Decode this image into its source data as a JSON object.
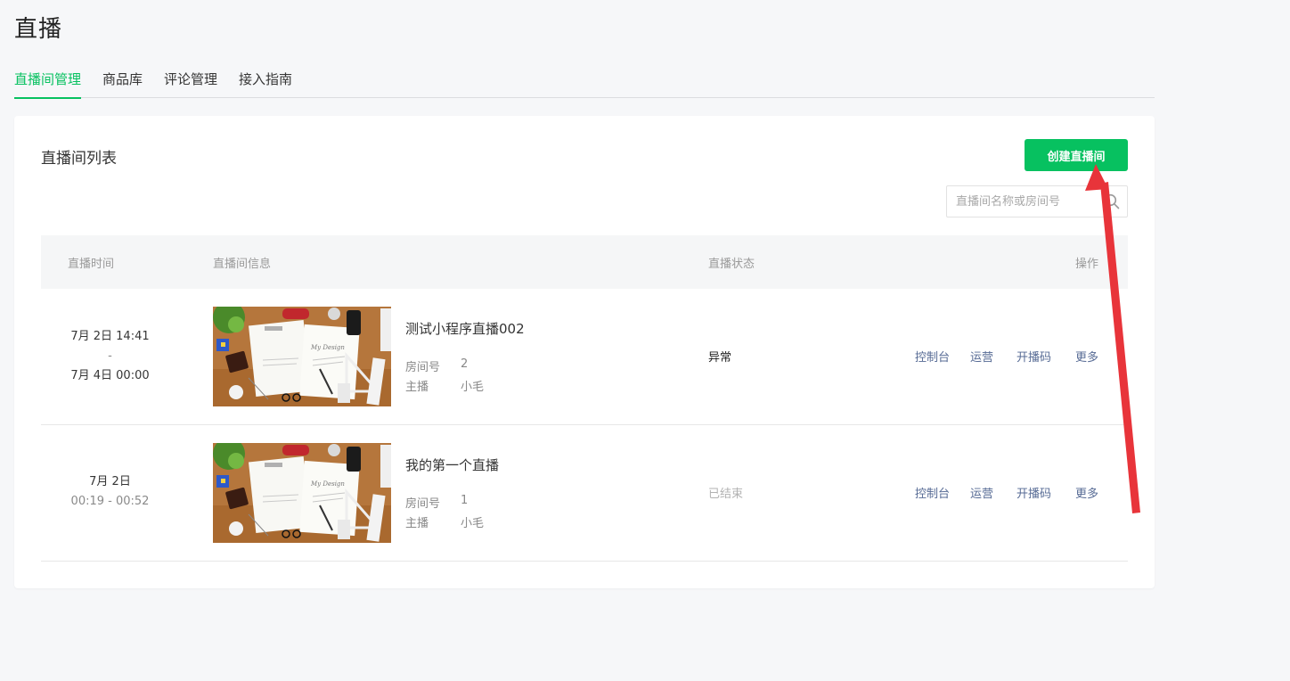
{
  "page": {
    "title": "直播"
  },
  "tabs": [
    {
      "label": "直播间管理",
      "active": true
    },
    {
      "label": "商品库",
      "active": false
    },
    {
      "label": "评论管理",
      "active": false
    },
    {
      "label": "接入指南",
      "active": false
    }
  ],
  "card": {
    "title": "直播间列表",
    "create_button": "创建直播间",
    "search_placeholder": "直播间名称或房间号"
  },
  "table": {
    "headers": {
      "time": "直播时间",
      "info": "直播间信息",
      "status": "直播状态",
      "ops": "操作"
    },
    "rows": [
      {
        "time_start": "7月 2日 14:41",
        "time_sep": "-",
        "time_end": "7月 4日 00:00",
        "name": "测试小程序直播002",
        "room_label": "房间号",
        "room_no": "2",
        "host_label": "主播",
        "host": "小毛",
        "status": "异常",
        "status_type": "abnormal",
        "actions": [
          "控制台",
          "运营",
          "开播码",
          "更多"
        ]
      },
      {
        "date": "7月 2日",
        "time_range": "00:19 - 00:52",
        "name": "我的第一个直播",
        "room_label": "房间号",
        "room_no": "1",
        "host_label": "主播",
        "host": "小毛",
        "status": "已结束",
        "status_type": "ended",
        "actions": [
          "控制台",
          "运营",
          "开播码",
          "更多"
        ]
      }
    ]
  },
  "colors": {
    "accent": "#07c160",
    "link": "#576b95",
    "annotation_arrow": "#e8343a"
  },
  "icons": {
    "search": "search-icon"
  }
}
